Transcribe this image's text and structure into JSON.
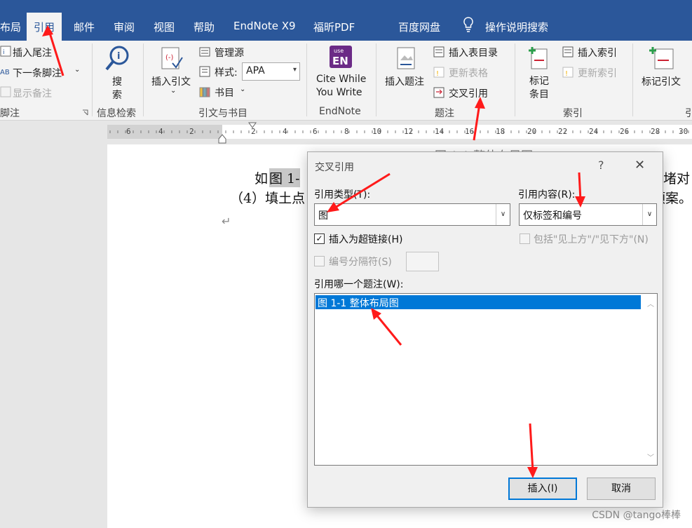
{
  "tabs": [
    {
      "label": "布局"
    },
    {
      "label": "引用"
    },
    {
      "label": "邮件"
    },
    {
      "label": "审阅"
    },
    {
      "label": "视图"
    },
    {
      "label": "帮助"
    },
    {
      "label": "EndNote X9"
    },
    {
      "label": "福昕PDF"
    },
    {
      "label": "百度网盘"
    },
    {
      "label": "操作说明搜索"
    }
  ],
  "ribbon": {
    "footnotes": {
      "insert_endnote": "插入尾注",
      "next_footnote": "下一条脚注",
      "show_notes": "显示备注",
      "group": "脚注"
    },
    "research": {
      "search": "搜",
      "search2": "索",
      "group": "信息检索"
    },
    "citations": {
      "insert_citation": "插入引文",
      "manage_sources": "管理源",
      "style_label": "样式:",
      "style_value": "APA",
      "bibliography": "书目",
      "group": "引文与书目"
    },
    "endnote": {
      "cite_line1": "Cite While",
      "cite_line2": "You Write",
      "group": "EndNote",
      "icon_top": "use",
      "icon_main": "EN"
    },
    "captions": {
      "insert_caption": "插入题注",
      "insert_table_of_figures": "插入表目录",
      "update_table": "更新表格",
      "cross_reference": "交叉引用",
      "group": "题注"
    },
    "index": {
      "mark_entry_1": "标记",
      "mark_entry_2": "条目",
      "insert_index": "插入索引",
      "update_index": "更新索引",
      "group": "索引"
    },
    "toa": {
      "mark_citation": "标记引文",
      "group": "引"
    }
  },
  "ruler": {
    "numbers": [
      "6",
      "4",
      "2",
      "2",
      "4",
      "6",
      "8",
      "10",
      "12",
      "14",
      "16",
      "18",
      "20",
      "22",
      "24",
      "26",
      "28",
      "30"
    ]
  },
  "document": {
    "line_top": "图 1-1 整体布局图",
    "line1_start": "如",
    "line1_sel": "图 1-",
    "line1_end": "堵对",
    "line2_start": "（4）填土点",
    "line2_end": "预案。"
  },
  "dialog": {
    "title": "交叉引用",
    "help": "?",
    "close": "✕",
    "ref_type_label": "引用类型(T):",
    "ref_type_value": "图",
    "ref_content_label": "引用内容(R):",
    "ref_content_value": "仅标签和编号",
    "insert_hyperlink_label": "插入为超链接(H)",
    "include_above_below_label": "包括\"见上方\"/\"见下方\"(N)",
    "separate_numbers_label": "编号分隔符(S)",
    "which_caption_label": "引用哪一个题注(W):",
    "caption_items": [
      "图 1-1 整体布局图"
    ],
    "insert_button": "插入(I)",
    "cancel_button": "取消"
  },
  "watermark": "CSDN @tango棒棒",
  "colors": {
    "accent": "#2b579a",
    "selection": "#0078d7",
    "annotation_arrow": "#ff1a1a"
  }
}
